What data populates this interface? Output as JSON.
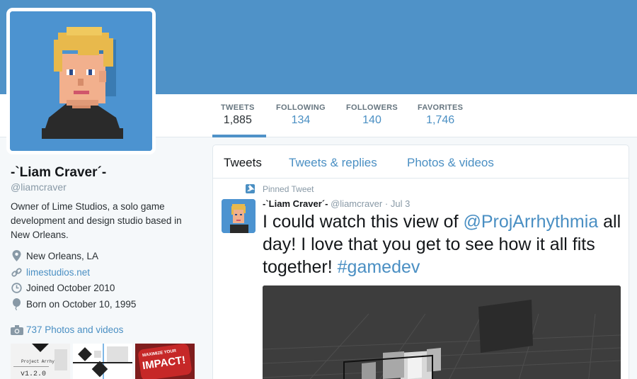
{
  "profile": {
    "name": "-`Liam Craver´-",
    "handle": "@liamcraver",
    "bio": "Owner of Lime Studios, a solo game development and design studio based in New Orleans.",
    "location": "New Orleans, LA",
    "website": "limestudios.net",
    "joined": "Joined October 2010",
    "born": "Born on October 10, 1995",
    "photos_label": "737 Photos and videos"
  },
  "stats": [
    {
      "label": "TWEETS",
      "value": "1,885"
    },
    {
      "label": "FOLLOWING",
      "value": "134"
    },
    {
      "label": "FOLLOWERS",
      "value": "140"
    },
    {
      "label": "FAVORITES",
      "value": "1,746"
    }
  ],
  "timeline": {
    "tabs": [
      "Tweets",
      "Tweets & replies",
      "Photos & videos"
    ],
    "pinned_label": "Pinned Tweet",
    "tweet": {
      "author": "-`Liam Craver´-",
      "handle": "@liamcraver",
      "separator": "·",
      "date": "Jul 3",
      "text_before": "I could watch this view of ",
      "mention": "@ProjArrhythmia",
      "text_after": " all day! I love that you get to see how it all fits together! ",
      "hashtag": "#gamedev"
    }
  },
  "thumbnails": {
    "thumb1_title": "Project Arrhythmia",
    "thumb1_caption": "v1.2.0",
    "thumb3_text_top": "MAXIMIZE YOUR",
    "thumb3_text_main": "IMPACT!"
  },
  "colors": {
    "banner": "#4f92c8",
    "link": "#4a8fc3",
    "avatar_bg": "#4c93d0"
  },
  "icons": {
    "location": "location-pin-icon",
    "website": "link-icon",
    "joined": "calendar-clock-icon",
    "born": "balloon-icon",
    "photos": "camera-icon",
    "pinned": "pin-icon"
  }
}
